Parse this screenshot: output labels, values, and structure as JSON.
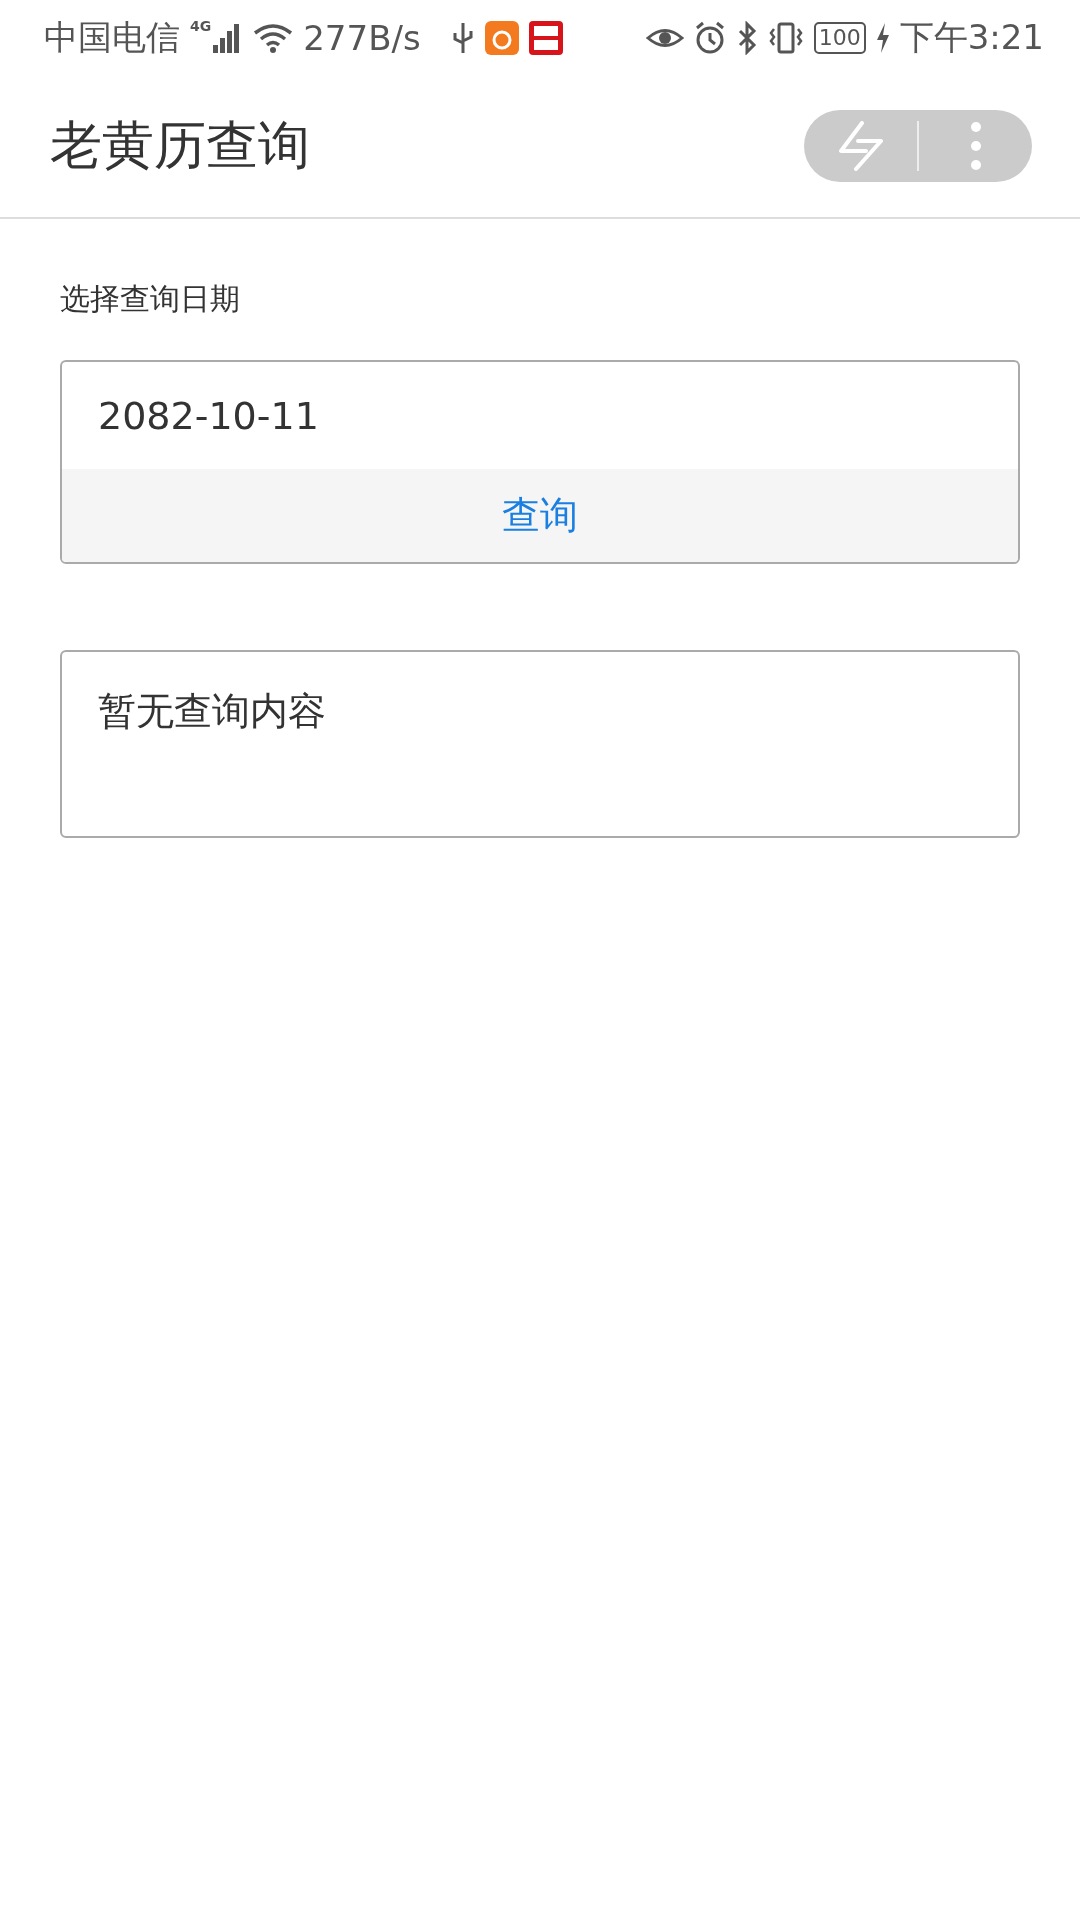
{
  "status_bar": {
    "carrier": "中国电信",
    "network": "4G",
    "speed": "277B/s",
    "battery": "100",
    "time": "下午3:21"
  },
  "header": {
    "title": "老黄历查询"
  },
  "date_label": "选择查询日期",
  "date_field": {
    "value": "2082-10-11"
  },
  "query_button": "查询",
  "result": {
    "text": "暂无查询内容"
  }
}
